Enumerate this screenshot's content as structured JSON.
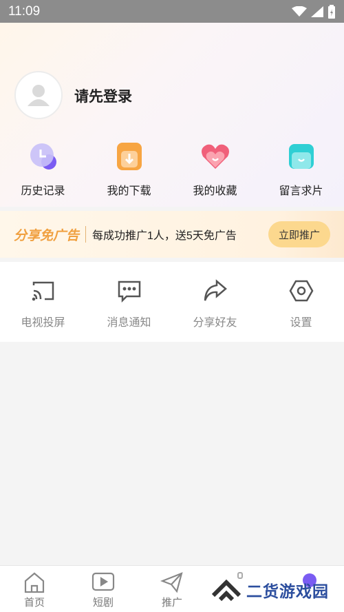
{
  "status_bar": {
    "time": "11:09"
  },
  "profile": {
    "login_prompt": "请先登录"
  },
  "quick_actions": [
    {
      "label": "历史记录",
      "icon": "history-icon"
    },
    {
      "label": "我的下载",
      "icon": "download-icon"
    },
    {
      "label": "我的收藏",
      "icon": "favorite-icon"
    },
    {
      "label": "留言求片",
      "icon": "message-request-icon"
    }
  ],
  "promo": {
    "title": "分享免广告",
    "text": "每成功推广1人，送5天免广告",
    "button": "立即推广"
  },
  "tools": [
    {
      "label": "电视投屏",
      "icon": "cast-icon"
    },
    {
      "label": "消息通知",
      "icon": "chat-icon"
    },
    {
      "label": "分享好友",
      "icon": "share-icon"
    },
    {
      "label": "设置",
      "icon": "settings-icon"
    }
  ],
  "bottom_nav": [
    {
      "label": "首页",
      "icon": "home-icon"
    },
    {
      "label": "短剧",
      "icon": "video-icon"
    },
    {
      "label": "推广",
      "icon": "send-icon"
    }
  ],
  "watermark": {
    "text": "二货游戏园"
  },
  "colors": {
    "accent": "#f0a040",
    "promo_button": "#fcd88e",
    "watermark": "#2c4e9e"
  }
}
